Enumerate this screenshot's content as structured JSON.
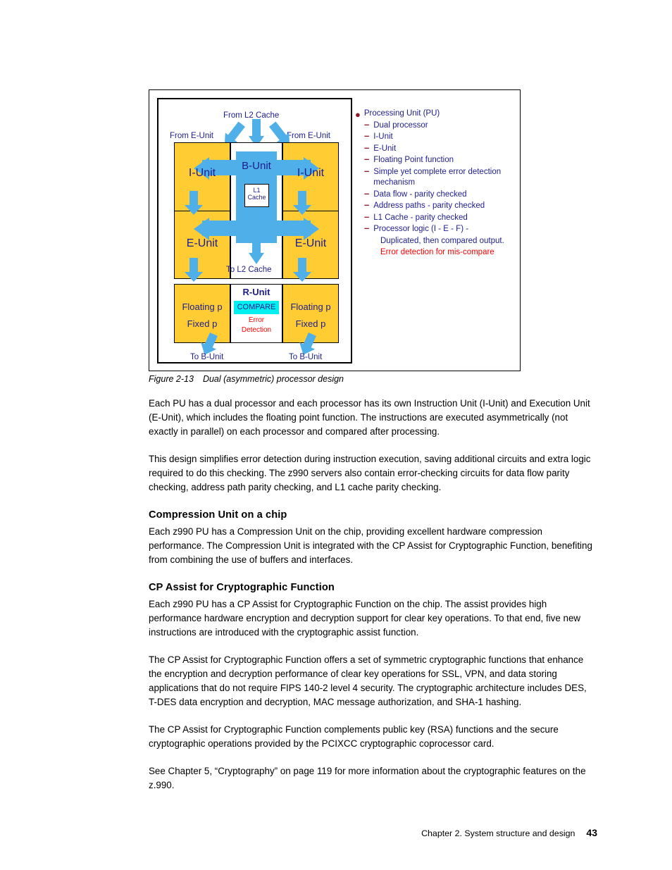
{
  "figure": {
    "caption_label": "Figure 2-13",
    "caption_text": "Dual (asymmetric) processor design",
    "diagram": {
      "labels": {
        "from_l2_cache": "From L2 Cache",
        "from_e_unit_left": "From E-Unit",
        "from_e_unit_right": "From E-Unit",
        "to_l2_cache": "To L2 Cache",
        "to_b_unit_left": "To B-Unit",
        "to_b_unit_right": "To B-Unit"
      },
      "blocks": {
        "b_unit": "B-Unit",
        "l1_cache_line1": "L1",
        "l1_cache_line2": "Cache",
        "i_unit_left": "I-Unit",
        "i_unit_right": "I-Unit",
        "e_unit_left": "E-Unit",
        "e_unit_right": "E-Unit",
        "floating_p_left": "Floating p",
        "fixed_p_left": "Fixed p",
        "floating_p_right": "Floating p",
        "fixed_p_right": "Fixed p",
        "r_unit": "R-Unit",
        "compare": "COMPARE",
        "error_detection_line1": "Error",
        "error_detection_line2": "Detection"
      },
      "colors": {
        "unit_fill": "#FFCC33",
        "arrow_blue": "#4FAFE8",
        "compare_cyan": "#00F0F0",
        "label_navy": "#1D1D8F",
        "alert_red": "#FF0000",
        "bullet_dark_red": "#8B1A2B"
      }
    },
    "bullets": [
      {
        "level": 0,
        "marker": "dot",
        "text": "Processing Unit (PU)",
        "color": "navy"
      },
      {
        "level": 1,
        "marker": "dash",
        "text": "Dual processor",
        "color": "navy"
      },
      {
        "level": 1,
        "marker": "dash",
        "text": "I-Unit",
        "color": "navy"
      },
      {
        "level": 1,
        "marker": "dash",
        "text": "E-Unit",
        "color": "navy"
      },
      {
        "level": 1,
        "marker": "dash",
        "text": "Floating Point function",
        "color": "navy"
      },
      {
        "level": 1,
        "marker": "dash",
        "text": "Simple yet complete error detection mechanism",
        "color": "navy"
      },
      {
        "level": 1,
        "marker": "dash",
        "text": "Data flow - parity checked",
        "color": "navy"
      },
      {
        "level": 1,
        "marker": "dash",
        "text": "Address paths - parity checked",
        "color": "navy"
      },
      {
        "level": 1,
        "marker": "dash",
        "text": "L1 Cache - parity checked",
        "color": "navy"
      },
      {
        "level": 1,
        "marker": "dash",
        "text": "Processor logic (I - E - F) -",
        "color": "navy"
      },
      {
        "level": 2,
        "marker": "none",
        "text": "Duplicated, then compared output.",
        "color": "navy"
      },
      {
        "level": 2,
        "marker": "none",
        "text": "Error detection for mis-compare",
        "color": "red"
      }
    ]
  },
  "body": {
    "para1": "Each PU has a dual processor and each processor has its own Instruction Unit (I-Unit) and Execution Unit (E-Unit), which includes the floating point function. The instructions are executed asymmetrically (not exactly in parallel) on each processor and compared after processing.",
    "para2": "This design simplifies error detection during instruction execution, saving additional circuits and extra logic required to do this checking. The z990 servers also contain error-checking circuits for data flow parity checking, address path parity checking, and L1 cache parity checking.",
    "heading1": "Compression Unit on a chip",
    "para3": "Each z990 PU has a Compression Unit on the chip, providing excellent hardware compression performance. The Compression Unit is integrated with the CP Assist for Cryptographic Function, benefiting from combining the use of buffers and interfaces.",
    "heading2": "CP Assist for Cryptographic Function",
    "para4": "Each z990 PU has a CP Assist for Cryptographic Function on the chip. The assist provides high performance hardware encryption and decryption support for clear key operations. To that end, five new instructions are introduced with the cryptographic assist function.",
    "para5": "The CP Assist for Cryptographic Function offers a set of symmetric cryptographic functions that enhance the encryption and decryption performance of clear key operations for SSL, VPN, and data storing applications that do not require FIPS 140-2 level 4 security. The cryptographic architecture includes DES, T-DES data encryption and decryption, MAC message authorization, and SHA-1 hashing.",
    "para6": "The CP Assist for Cryptographic Function complements public key (RSA) functions and the secure cryptographic operations provided by the PCIXCC cryptographic coprocessor card.",
    "para7": "See Chapter 5, “Cryptography” on page 119 for more information about the cryptographic features on the z.990."
  },
  "footer": {
    "chapter_text": "Chapter 2. System structure and design",
    "page_number": "43"
  }
}
